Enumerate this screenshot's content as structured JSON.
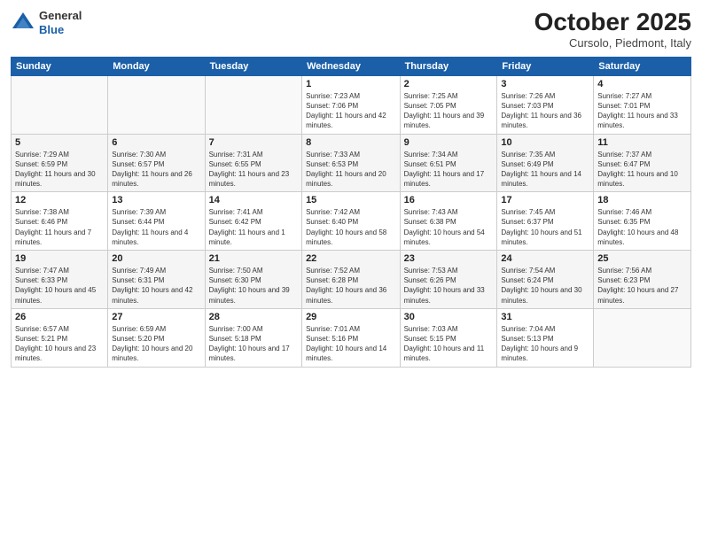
{
  "header": {
    "logo_general": "General",
    "logo_blue": "Blue",
    "month_title": "October 2025",
    "location": "Cursolo, Piedmont, Italy"
  },
  "weekdays": [
    "Sunday",
    "Monday",
    "Tuesday",
    "Wednesday",
    "Thursday",
    "Friday",
    "Saturday"
  ],
  "weeks": [
    [
      {
        "day": "",
        "info": ""
      },
      {
        "day": "",
        "info": ""
      },
      {
        "day": "",
        "info": ""
      },
      {
        "day": "1",
        "info": "Sunrise: 7:23 AM\nSunset: 7:06 PM\nDaylight: 11 hours and 42 minutes."
      },
      {
        "day": "2",
        "info": "Sunrise: 7:25 AM\nSunset: 7:05 PM\nDaylight: 11 hours and 39 minutes."
      },
      {
        "day": "3",
        "info": "Sunrise: 7:26 AM\nSunset: 7:03 PM\nDaylight: 11 hours and 36 minutes."
      },
      {
        "day": "4",
        "info": "Sunrise: 7:27 AM\nSunset: 7:01 PM\nDaylight: 11 hours and 33 minutes."
      }
    ],
    [
      {
        "day": "5",
        "info": "Sunrise: 7:29 AM\nSunset: 6:59 PM\nDaylight: 11 hours and 30 minutes."
      },
      {
        "day": "6",
        "info": "Sunrise: 7:30 AM\nSunset: 6:57 PM\nDaylight: 11 hours and 26 minutes."
      },
      {
        "day": "7",
        "info": "Sunrise: 7:31 AM\nSunset: 6:55 PM\nDaylight: 11 hours and 23 minutes."
      },
      {
        "day": "8",
        "info": "Sunrise: 7:33 AM\nSunset: 6:53 PM\nDaylight: 11 hours and 20 minutes."
      },
      {
        "day": "9",
        "info": "Sunrise: 7:34 AM\nSunset: 6:51 PM\nDaylight: 11 hours and 17 minutes."
      },
      {
        "day": "10",
        "info": "Sunrise: 7:35 AM\nSunset: 6:49 PM\nDaylight: 11 hours and 14 minutes."
      },
      {
        "day": "11",
        "info": "Sunrise: 7:37 AM\nSunset: 6:47 PM\nDaylight: 11 hours and 10 minutes."
      }
    ],
    [
      {
        "day": "12",
        "info": "Sunrise: 7:38 AM\nSunset: 6:46 PM\nDaylight: 11 hours and 7 minutes."
      },
      {
        "day": "13",
        "info": "Sunrise: 7:39 AM\nSunset: 6:44 PM\nDaylight: 11 hours and 4 minutes."
      },
      {
        "day": "14",
        "info": "Sunrise: 7:41 AM\nSunset: 6:42 PM\nDaylight: 11 hours and 1 minute."
      },
      {
        "day": "15",
        "info": "Sunrise: 7:42 AM\nSunset: 6:40 PM\nDaylight: 10 hours and 58 minutes."
      },
      {
        "day": "16",
        "info": "Sunrise: 7:43 AM\nSunset: 6:38 PM\nDaylight: 10 hours and 54 minutes."
      },
      {
        "day": "17",
        "info": "Sunrise: 7:45 AM\nSunset: 6:37 PM\nDaylight: 10 hours and 51 minutes."
      },
      {
        "day": "18",
        "info": "Sunrise: 7:46 AM\nSunset: 6:35 PM\nDaylight: 10 hours and 48 minutes."
      }
    ],
    [
      {
        "day": "19",
        "info": "Sunrise: 7:47 AM\nSunset: 6:33 PM\nDaylight: 10 hours and 45 minutes."
      },
      {
        "day": "20",
        "info": "Sunrise: 7:49 AM\nSunset: 6:31 PM\nDaylight: 10 hours and 42 minutes."
      },
      {
        "day": "21",
        "info": "Sunrise: 7:50 AM\nSunset: 6:30 PM\nDaylight: 10 hours and 39 minutes."
      },
      {
        "day": "22",
        "info": "Sunrise: 7:52 AM\nSunset: 6:28 PM\nDaylight: 10 hours and 36 minutes."
      },
      {
        "day": "23",
        "info": "Sunrise: 7:53 AM\nSunset: 6:26 PM\nDaylight: 10 hours and 33 minutes."
      },
      {
        "day": "24",
        "info": "Sunrise: 7:54 AM\nSunset: 6:24 PM\nDaylight: 10 hours and 30 minutes."
      },
      {
        "day": "25",
        "info": "Sunrise: 7:56 AM\nSunset: 6:23 PM\nDaylight: 10 hours and 27 minutes."
      }
    ],
    [
      {
        "day": "26",
        "info": "Sunrise: 6:57 AM\nSunset: 5:21 PM\nDaylight: 10 hours and 23 minutes."
      },
      {
        "day": "27",
        "info": "Sunrise: 6:59 AM\nSunset: 5:20 PM\nDaylight: 10 hours and 20 minutes."
      },
      {
        "day": "28",
        "info": "Sunrise: 7:00 AM\nSunset: 5:18 PM\nDaylight: 10 hours and 17 minutes."
      },
      {
        "day": "29",
        "info": "Sunrise: 7:01 AM\nSunset: 5:16 PM\nDaylight: 10 hours and 14 minutes."
      },
      {
        "day": "30",
        "info": "Sunrise: 7:03 AM\nSunset: 5:15 PM\nDaylight: 10 hours and 11 minutes."
      },
      {
        "day": "31",
        "info": "Sunrise: 7:04 AM\nSunset: 5:13 PM\nDaylight: 10 hours and 9 minutes."
      },
      {
        "day": "",
        "info": ""
      }
    ]
  ]
}
